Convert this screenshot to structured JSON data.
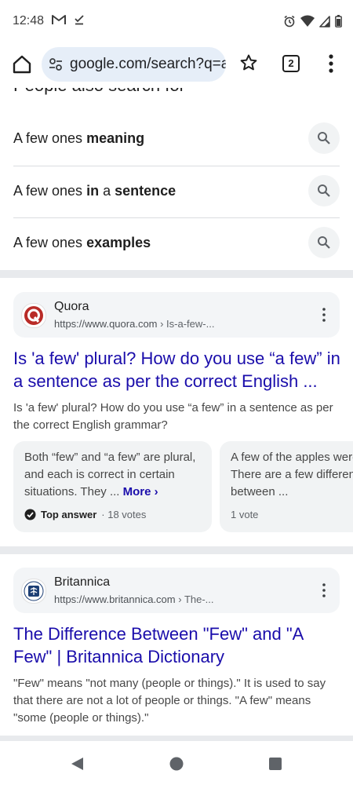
{
  "status_bar": {
    "time": "12:48"
  },
  "toolbar": {
    "url": "google.com/search?q=a",
    "tab_count": "2"
  },
  "paa": {
    "header": "People also search for",
    "suggestions": [
      {
        "normal": "A few ones ",
        "bold": "meaning",
        "normal2": "",
        "bold2": ""
      },
      {
        "normal": "A few ones ",
        "bold": "in",
        "normal2": " a ",
        "bold2": "sentence"
      },
      {
        "normal": "A few ones ",
        "bold": "examples",
        "normal2": "",
        "bold2": ""
      }
    ]
  },
  "results": [
    {
      "source_name": "Quora",
      "url": "https://www.quora.com",
      "breadcrumb": " › Is-a-few-...",
      "title": "Is 'a few' plural? How do you use “a few” in a sentence as per the correct English ...",
      "snippet": "Is 'a few' plural? How do you use “a few” in a sentence as per the correct English grammar?",
      "answers": [
        {
          "text": "Both “few” and “a few” are plural, and each is correct in certain situations. They ... ",
          "more": "More ›",
          "badge": "Top answer",
          "votes": " · 18 votes"
        },
        {
          "text": "A few of the apples were (Plural) There are a few differences between ...",
          "more": "",
          "badge": "",
          "votes": "1 vote"
        }
      ]
    },
    {
      "source_name": "Britannica",
      "url": "https://www.britannica.com",
      "breadcrumb": " › The-...",
      "title": "The Difference Between \"Few\" and \"A Few\" | Britannica Dictionary",
      "snippet": "\"Few\" means \"not many (people or things).\" It is used to say that there are not a lot of people or things. \"A few\" means \"some (people or things).\""
    }
  ],
  "colors": {
    "link": "#1a0dab",
    "pill": "#e6eef8",
    "card": "#f1f3f4",
    "quora_red": "#b92b27",
    "britannica_blue": "#1d3f75"
  }
}
